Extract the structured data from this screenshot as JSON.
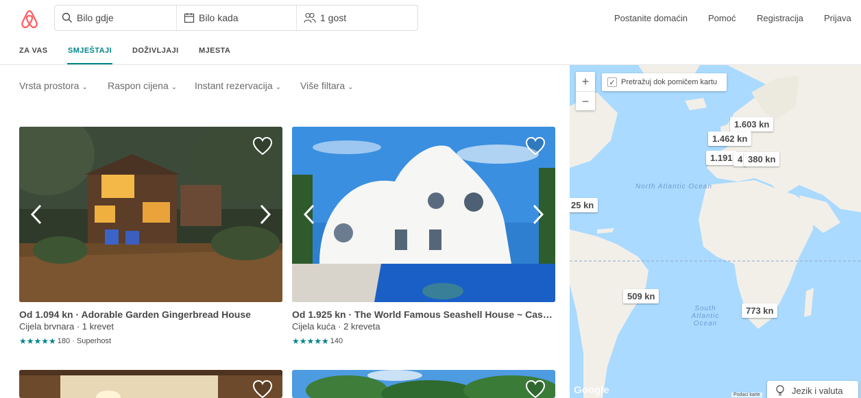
{
  "header": {
    "search": {
      "where": "Bilo gdje",
      "when": "Bilo kada",
      "guests": "1 gost"
    },
    "nav": [
      "Postanite domaćin",
      "Pomoć",
      "Registracija",
      "Prijava"
    ]
  },
  "tabs": [
    "ZA VAS",
    "SMJEŠTAJI",
    "DOŽIVLJAJI",
    "MJESTA"
  ],
  "filters": [
    "Vrsta prostora",
    "Raspon cijena",
    "Instant rezervacija",
    "Više filtara"
  ],
  "listings": [
    {
      "title": "Od 1.094 kn · Adorable Garden Gingerbread House",
      "subtitle": "Cijela brvnara · 1 krevet",
      "stars": "★★★★★",
      "reviews": "180 · Superhost"
    },
    {
      "title": "Od 1.925 kn · The World Famous Seashell House ~ Casa ...",
      "subtitle": "Cijela kuća · 2 kreveta",
      "stars": "★★★★★",
      "reviews": "140"
    }
  ],
  "map": {
    "search_as_move": "Pretražuj dok pomičem kartu",
    "zoom_in": "+",
    "zoom_out": "−",
    "pins": [
      "1.603 kn",
      "1.462 kn",
      "1.191",
      "4",
      "380 kn",
      "25 kn",
      "509 kn",
      "773 kn"
    ],
    "oceans": {
      "north_atlantic": "North Atlantic Ocean",
      "south_atlantic": "South Atlantic Ocean"
    },
    "google": "Google",
    "map_data": "Podaci karte",
    "language": "Jezik i valuta"
  },
  "colors": {
    "brand": "#ff5a5f",
    "accent": "#008489",
    "water": "#aadaff",
    "land": "#f2efe9"
  }
}
